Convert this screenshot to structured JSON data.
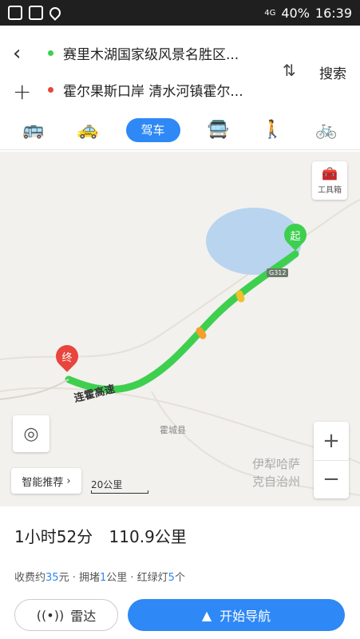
{
  "statusbar": {
    "battery": "40%",
    "time": "16:39",
    "net": "4G"
  },
  "route": {
    "start": "赛里木湖国家级风景名胜区...",
    "end": "霍尔果斯口岸 清水河镇霍尔...",
    "search_label": "搜索"
  },
  "modes": {
    "icons": [
      "bus-icon",
      "taxi-icon",
      "drive",
      "transit-icon",
      "walk-icon",
      "bike-icon"
    ],
    "active_label": "驾车"
  },
  "map": {
    "tool_label": "工具箱",
    "recommend_label": "智能推荐",
    "scale": "20公里",
    "labels": {
      "county": "霍城县",
      "prefecture_1": "伊犁哈萨",
      "prefecture_2": "克自治州",
      "road": "连霍高速",
      "shield": "G312"
    },
    "start_pin": "起",
    "end_pin": "终",
    "route_color": "#3ecf4f",
    "start_color": "#3ecf4f",
    "end_color": "#e8453c"
  },
  "summary": {
    "duration": "1小时52分",
    "distance": "110.9公里",
    "fee_prefix": "收费约",
    "fee_value": "35",
    "fee_unit": "元 · 拥堵",
    "jam_value": "1",
    "jam_unit": "公里 · 红绿灯",
    "lights_value": "5",
    "lights_unit": "个"
  },
  "buttons": {
    "radar": "雷达",
    "navigate": "开始导航"
  }
}
